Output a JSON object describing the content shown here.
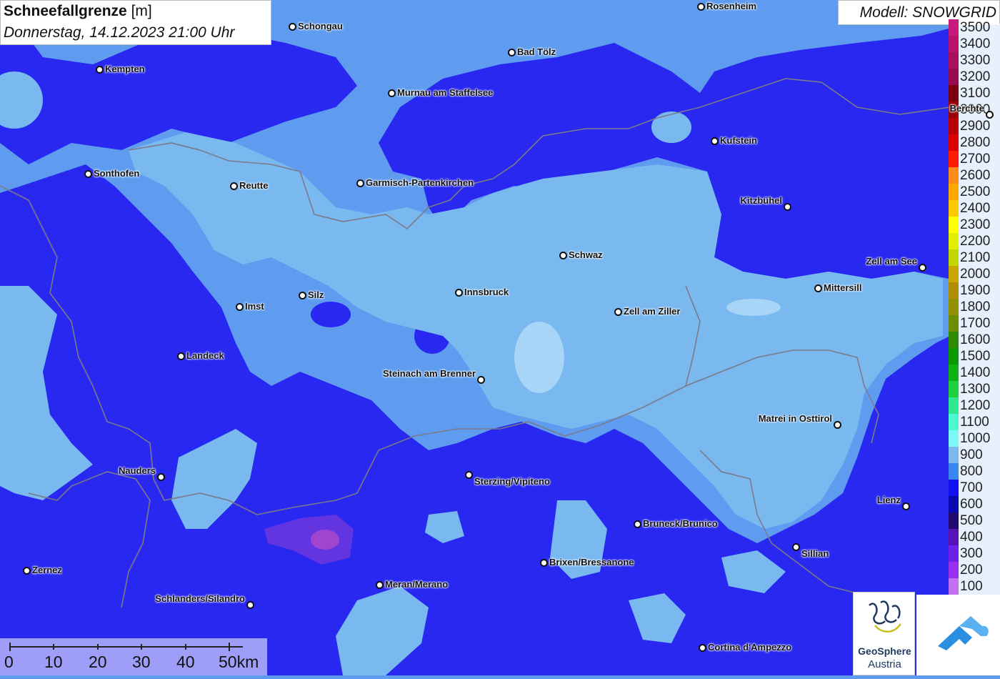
{
  "title": {
    "main": "Schneefallgrenze",
    "unit": "[m]",
    "datetime": "Donnerstag, 14.12.2023 21:00 Uhr"
  },
  "model": "Modell: SNOWGRID",
  "legend": {
    "items": [
      {
        "label": "3500",
        "color": "#c81a7c"
      },
      {
        "label": "3400",
        "color": "#b8146e"
      },
      {
        "label": "3300",
        "color": "#a80f60"
      },
      {
        "label": "3200",
        "color": "#960a52"
      },
      {
        "label": "3100",
        "color": "#7a0010"
      },
      {
        "label": "3000",
        "color": "#9a0008"
      },
      {
        "label": "2900",
        "color": "#b80004"
      },
      {
        "label": "2800",
        "color": "#d80000"
      },
      {
        "label": "2700",
        "color": "#ff1a00"
      },
      {
        "label": "2600",
        "color": "#ff8a1a"
      },
      {
        "label": "2500",
        "color": "#ffa800"
      },
      {
        "label": "2400",
        "color": "#ffc800"
      },
      {
        "label": "2300",
        "color": "#ffff00"
      },
      {
        "label": "2200",
        "color": "#e0f000"
      },
      {
        "label": "2100",
        "color": "#c0d800"
      },
      {
        "label": "2000",
        "color": "#c8a800"
      },
      {
        "label": "1900",
        "color": "#b08c00"
      },
      {
        "label": "1800",
        "color": "#909000"
      },
      {
        "label": "1700",
        "color": "#6e8c00"
      },
      {
        "label": "1600",
        "color": "#2e8a00"
      },
      {
        "label": "1500",
        "color": "#0a9a00"
      },
      {
        "label": "1400",
        "color": "#10b010"
      },
      {
        "label": "1300",
        "color": "#20d040"
      },
      {
        "label": "1200",
        "color": "#2ee890"
      },
      {
        "label": "1100",
        "color": "#4cf8d0"
      },
      {
        "label": "1000",
        "color": "#7cf8f8"
      },
      {
        "label": "900",
        "color": "#7ab8f0"
      },
      {
        "label": "800",
        "color": "#3a86f0"
      },
      {
        "label": "700",
        "color": "#1010f0"
      },
      {
        "label": "600",
        "color": "#0808b0"
      },
      {
        "label": "500",
        "color": "#200870"
      },
      {
        "label": "400",
        "color": "#5810b8"
      },
      {
        "label": "300",
        "color": "#6e20e8"
      },
      {
        "label": "200",
        "color": "#9a2ef0"
      },
      {
        "label": "100",
        "color": "#c070f0"
      }
    ]
  },
  "cities": [
    {
      "name": "Kempten"
    },
    {
      "name": "Schongau"
    },
    {
      "name": "Rosenheim"
    },
    {
      "name": "Bad Tölz"
    },
    {
      "name": "Murnau am Staffelsee"
    },
    {
      "name": "Berchte"
    },
    {
      "name": "Kufstein"
    },
    {
      "name": "Sonthofen"
    },
    {
      "name": "Reutte"
    },
    {
      "name": "Garmisch-Partenkirchen"
    },
    {
      "name": "Kitzbühel"
    },
    {
      "name": "Schwaz"
    },
    {
      "name": "Zell am See"
    },
    {
      "name": "Mittersill"
    },
    {
      "name": "Silz"
    },
    {
      "name": "Innsbruck"
    },
    {
      "name": "Imst"
    },
    {
      "name": "Zell am Ziller"
    },
    {
      "name": "Landeck"
    },
    {
      "name": "Steinach am Brenner"
    },
    {
      "name": "Matrei in Osttirol"
    },
    {
      "name": "Nauders"
    },
    {
      "name": "Sterzing/Vipiteno"
    },
    {
      "name": "Lienz"
    },
    {
      "name": "Bruneck/Brunico"
    },
    {
      "name": "Sillian"
    },
    {
      "name": "Zernez"
    },
    {
      "name": "Brixen/Bressanone"
    },
    {
      "name": "Meran/Merano"
    },
    {
      "name": "Schlanders/Silandro"
    },
    {
      "name": "Cortina d'Ampezzo"
    }
  ],
  "scale": {
    "labels": [
      "0",
      "10",
      "20",
      "30",
      "40",
      "50km"
    ]
  },
  "logos": {
    "geosphere_line1": "GeoSphere",
    "geosphere_line2": "Austria"
  },
  "colors": {
    "light_blue_900": "#7ab8f0",
    "mid_blue_800": "#5f9cf0",
    "deep_blue_700": "#2828f0",
    "purple_core": "#a03ad8",
    "border_grey": "#7a7a8a"
  }
}
